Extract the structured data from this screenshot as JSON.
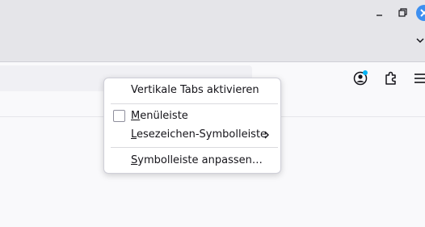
{
  "window": {
    "controls": [
      "minimize-icon",
      "maximize-icon",
      "close-icon"
    ],
    "accent": "#3d8ff0"
  },
  "toolbar": {
    "icons": [
      "account-icon",
      "extensions-icon",
      "hamburger-menu-icon"
    ],
    "account_badge_color": "#00b3f4"
  },
  "context_menu": {
    "vertical_tabs": "Vertikale Tabs aktivieren",
    "menubar": {
      "accel": "M",
      "rest": "enüleiste",
      "checked": false
    },
    "bookmarks_toolbar": {
      "accel": "L",
      "rest": "esezeichen-Symbolleiste"
    },
    "customize": {
      "accel": "S",
      "rest": "ymbolleiste anpassen…"
    }
  }
}
